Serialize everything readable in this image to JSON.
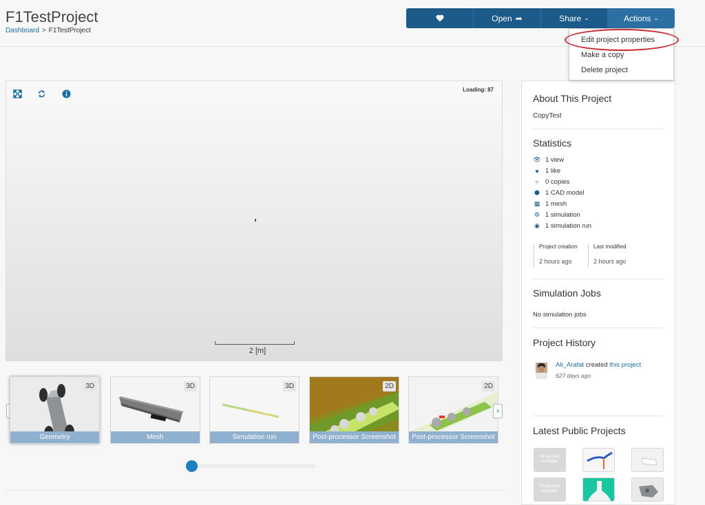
{
  "header": {
    "title": "F1TestProject",
    "breadcrumb": {
      "home": "Dashboard",
      "separator": ">",
      "current": "F1TestProject"
    },
    "buttons": {
      "like_icon": "heart-icon",
      "open": "Open",
      "share": "Share",
      "actions": "Actions"
    }
  },
  "actions_menu": {
    "items": [
      "Edit project properties",
      "Make a copy",
      "Delete project"
    ],
    "highlighted": "Edit project properties"
  },
  "viewer": {
    "loading": "Loading: 87",
    "scale_label": "2 [m]",
    "tools": [
      "fullscreen-icon",
      "refresh-icon",
      "info-icon"
    ]
  },
  "carousel": {
    "items": [
      {
        "label": "Geometry",
        "badge": "3D"
      },
      {
        "label": "Mesh",
        "badge": "3D"
      },
      {
        "label": "Simulation run",
        "badge": "3D"
      },
      {
        "label": "Post-processor Screenshot",
        "badge": "2D"
      },
      {
        "label": "Post-processor Screenshot",
        "badge": "2D"
      }
    ],
    "prev": "‹",
    "next": "›"
  },
  "sidebar": {
    "about_title": "About This Project",
    "description": "CopyTest",
    "stats_title": "Statistics",
    "stats": [
      {
        "icon": "eye-icon",
        "text": "1 view"
      },
      {
        "icon": "heart-icon",
        "text": "1 like"
      },
      {
        "icon": "fork-icon",
        "text": "0 copies"
      },
      {
        "icon": "cube-icon",
        "text": "1 CAD model"
      },
      {
        "icon": "grid-icon",
        "text": "1 mesh"
      },
      {
        "icon": "gears-icon",
        "text": "1 simulation"
      },
      {
        "icon": "play-circle-icon",
        "text": "1 simulation run"
      }
    ],
    "created_label": "Project creation",
    "created_value": "2 hours ago",
    "modified_label": "Last modified",
    "modified_value": "2 hours ago",
    "jobs_title": "Simulation Jobs",
    "jobs_text": "No simulation jobs",
    "history_title": "Project History",
    "history": {
      "user": "Ali_Arafat",
      "verb": "created",
      "link": "this project",
      "time": "627 days ago"
    },
    "latest_title": "Latest Public Projects",
    "no_preview": "No preview available"
  }
}
